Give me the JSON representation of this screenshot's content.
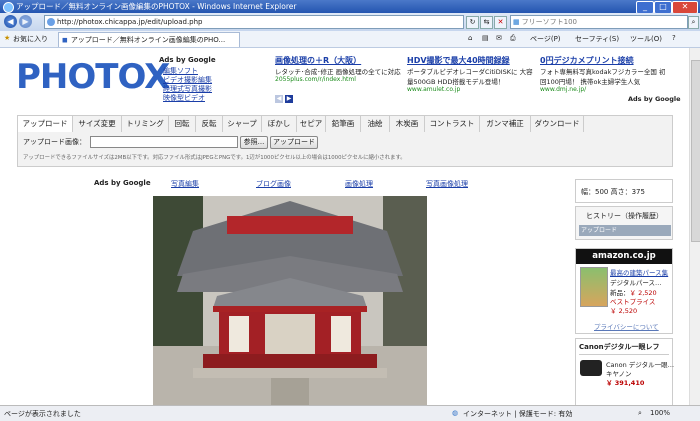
{
  "window": {
    "title": "アップロード／無料オンライン画像編集のPHOTOX - Windows Internet Explorer"
  },
  "address": {
    "url": "http://photox.chicappa.jp/edit/upload.php",
    "search_placeholder": "フリーソフト100"
  },
  "favorites": {
    "label": "お気に入り",
    "tab": "アップロード／無料オンライン画像編集のPHO...",
    "tools": [
      "ページ(P)",
      "セーフティ(S)",
      "ツール(O)"
    ]
  },
  "page": {
    "logo": "PHOTOX",
    "ads_by_google": "Ads by Google",
    "side_links": [
      "編集ソフト",
      "ビデオ撮影編集",
      "経理式写真撮影",
      "映像型ビデオ"
    ],
    "ads": [
      {
        "title": "画像処理の＋R（大阪）",
        "text": "レタッチ･合成･修正 画像処理の全てに対応",
        "url": "2055plus.com/r/index.html"
      },
      {
        "title": "HDV撮影で最大40時間録録",
        "text": "ポータブルビデオレコーダCitiDISKに 大容量500GB HDD搭載モデル登場！",
        "url": "www.amulet.co.jp"
      },
      {
        "title": "0円デジカメプリント接続",
        "text": "フォト専無料写真kodakフジカラー全国 初回100円場！ 携帯ok主婦学生人気",
        "url": "www.dmj.ne.jp/"
      }
    ],
    "tabs": [
      "アップロード",
      "サイズ変更",
      "トリミング",
      "回転",
      "反転",
      "シャープ",
      "ぼかし",
      "セピア",
      "鉛筆画",
      "油絵",
      "木炭画",
      "コントラスト",
      "ガンマ補正",
      "ダウンロード"
    ],
    "upload_label": "アップロード画像：",
    "browse_button": "参照...",
    "upload_button": "アップロード",
    "upload_note": "アップロードできるファイルサイズは2MB以下です。対応ファイル形式はJPEGとPNGです。1辺が1000ピクセル以上の場合は1000ピクセルに縮小されます。",
    "ad_row": [
      "Ads by Google",
      "写真編集",
      "ブログ画像",
      "画像処理",
      "写真画像処理"
    ],
    "size_info": "幅：500 高さ：375",
    "history_title": "ヒストリー（操作履歴）",
    "history_item": "アップロード",
    "amazon": {
      "logo": "amazon.co.jp",
      "book_title": "最高の建築パース集",
      "product": "デジタルパース…",
      "new_label": "新品：",
      "price_new": "￥ 2,520",
      "best_label": "ベストプライス",
      "price_best": "￥ 2,520",
      "privacy": "プライバシーについて"
    },
    "canon": {
      "title": "Canonデジタル一眼レフ",
      "product": "Canon デジタル一眼…",
      "brand": "キヤノン",
      "price": "￥ 391,410"
    }
  },
  "status": {
    "left": "ページが表示されました",
    "zone": "インターネット | 保護モード: 有効",
    "zoom": "100%"
  }
}
